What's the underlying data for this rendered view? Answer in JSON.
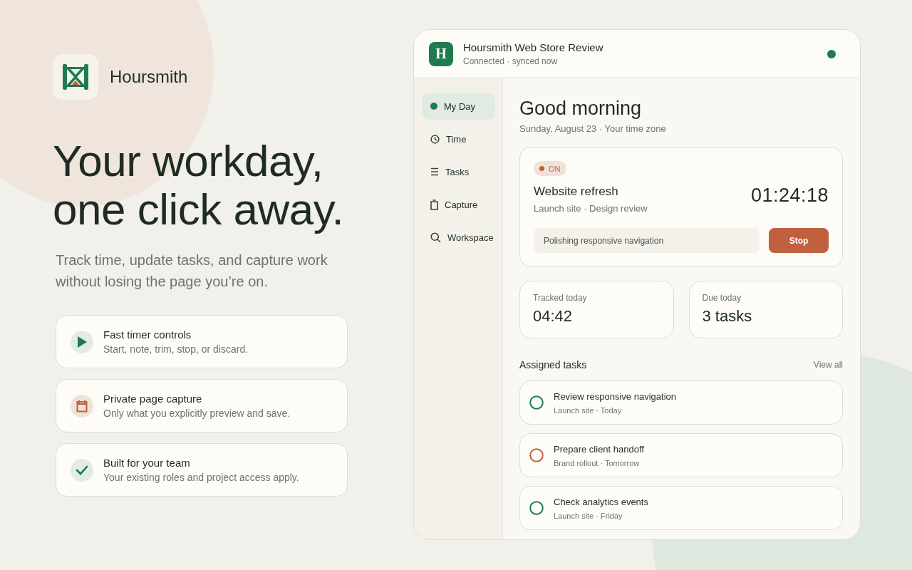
{
  "brand": {
    "name": "Hoursmith"
  },
  "hero": {
    "title_lines": [
      "Your workday,",
      "one click away."
    ],
    "subtitle": "Track time, update tasks, and capture work without losing the page you’re on."
  },
  "features": [
    {
      "kind": "play",
      "title": "Fast timer controls",
      "description": "Start, note, trim, stop, or discard."
    },
    {
      "kind": "calendar",
      "title": "Private page capture",
      "description": "Only what you explicitly preview and save."
    },
    {
      "kind": "check",
      "title": "Built for your team",
      "description": "Your existing roles and project access apply."
    }
  ],
  "app": {
    "header": {
      "logo_letter": "H",
      "title": "Hoursmith Web Store Review",
      "status": "Connected · synced now",
      "connected": true
    },
    "nav": [
      {
        "kind": "dot",
        "label": "My Day",
        "selected": true
      },
      {
        "kind": "clock",
        "label": "Time",
        "selected": false
      },
      {
        "kind": "list",
        "label": "Tasks",
        "selected": false
      },
      {
        "kind": "clip",
        "label": "Capture",
        "selected": false
      },
      {
        "kind": "search",
        "label": "Workspace",
        "selected": false
      }
    ],
    "greeting": "Good morning",
    "date_line": "Sunday, August 23 · Your time zone",
    "timer": {
      "badge": "ON",
      "running": true,
      "project": "Website refresh",
      "meta": "Launch site · Design review",
      "elapsed": "01:24:18",
      "note": "Polishing responsive navigation",
      "button": "Stop"
    },
    "stats": [
      {
        "label": "Tracked today",
        "value": "04:42"
      },
      {
        "label": "Due today",
        "value": "3 tasks"
      }
    ],
    "tasks_title": "Assigned tasks",
    "view_all": "View all",
    "tasks": [
      {
        "title": "Review responsive navigation",
        "meta": "Launch site · Today",
        "color": "#1e7a4f"
      },
      {
        "title": "Prepare client handoff",
        "meta": "Brand rollout · Tomorrow",
        "color": "#c0603f"
      },
      {
        "title": "Check analytics events",
        "meta": "Launch site · Friday",
        "color": "#1e7a4f"
      }
    ]
  }
}
